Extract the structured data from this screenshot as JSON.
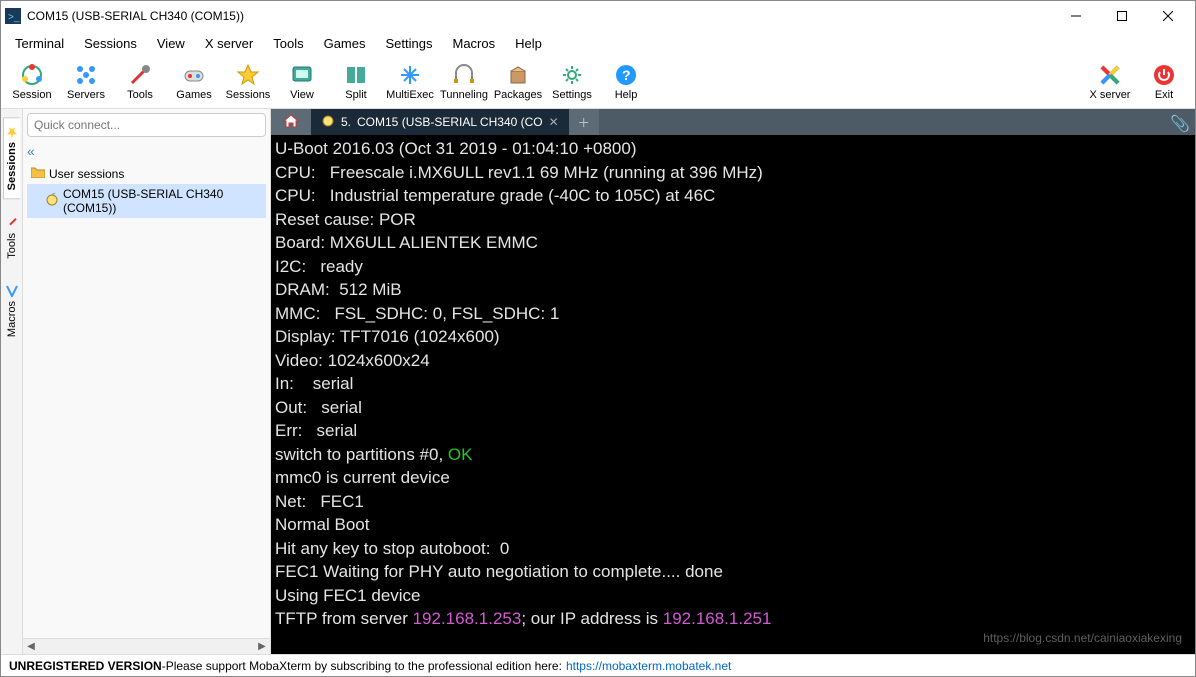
{
  "window": {
    "title": "COM15  (USB-SERIAL CH340 (COM15))"
  },
  "menu": [
    "Terminal",
    "Sessions",
    "View",
    "X server",
    "Tools",
    "Games",
    "Settings",
    "Macros",
    "Help"
  ],
  "toolbar": {
    "left": [
      {
        "label": "Session",
        "icon": "session-icon"
      },
      {
        "label": "Servers",
        "icon": "servers-icon"
      },
      {
        "label": "Tools",
        "icon": "tools-icon"
      },
      {
        "label": "Games",
        "icon": "games-icon"
      },
      {
        "label": "Sessions",
        "icon": "sessions-star-icon"
      },
      {
        "label": "View",
        "icon": "view-icon"
      },
      {
        "label": "Split",
        "icon": "split-icon"
      },
      {
        "label": "MultiExec",
        "icon": "multiexec-icon"
      },
      {
        "label": "Tunneling",
        "icon": "tunneling-icon"
      },
      {
        "label": "Packages",
        "icon": "packages-icon"
      },
      {
        "label": "Settings",
        "icon": "settings-icon"
      },
      {
        "label": "Help",
        "icon": "help-icon"
      }
    ],
    "right": [
      {
        "label": "X server",
        "icon": "xserver-icon"
      },
      {
        "label": "Exit",
        "icon": "exit-icon"
      }
    ]
  },
  "quick_connect": {
    "placeholder": "Quick connect..."
  },
  "side_tabs": [
    "Sessions",
    "Tools",
    "Macros"
  ],
  "session_tree": {
    "root": "User sessions",
    "item": "COM15  (USB-SERIAL CH340 (COM15))"
  },
  "tabs": {
    "active": {
      "index": "5.",
      "label": "COM15  (USB-SERIAL CH340 (CO"
    }
  },
  "terminal_lines": [
    {
      "t": "U-Boot 2016.03 (Oct 31 2019 - 01:04:10 +0800)"
    },
    {
      "t": ""
    },
    {
      "t": "CPU:   Freescale i.MX6ULL rev1.1 69 MHz (running at 396 MHz)"
    },
    {
      "t": "CPU:   Industrial temperature grade (-40C to 105C) at 46C"
    },
    {
      "t": "Reset cause: POR"
    },
    {
      "t": "Board: MX6ULL ALIENTEK EMMC"
    },
    {
      "t": "I2C:   ready"
    },
    {
      "t": "DRAM:  512 MiB"
    },
    {
      "t": "MMC:   FSL_SDHC: 0, FSL_SDHC: 1"
    },
    {
      "t": "Display: TFT7016 (1024x600)"
    },
    {
      "t": "Video: 1024x600x24"
    },
    {
      "t": "In:    serial"
    },
    {
      "t": "Out:   serial"
    },
    {
      "t": "Err:   serial"
    },
    {
      "spans": [
        {
          "t": "switch to partitions #0, "
        },
        {
          "t": "OK",
          "cls": "green"
        }
      ]
    },
    {
      "t": "mmc0 is current device"
    },
    {
      "t": "Net:   FEC1"
    },
    {
      "t": "Normal Boot"
    },
    {
      "t": "Hit any key to stop autoboot:  0"
    },
    {
      "t": "FEC1 Waiting for PHY auto negotiation to complete.... done"
    },
    {
      "t": "Using FEC1 device"
    },
    {
      "spans": [
        {
          "t": "TFTP from server "
        },
        {
          "t": "192.168.1.253",
          "cls": "magenta"
        },
        {
          "t": "; our IP address is "
        },
        {
          "t": "192.168.1.251",
          "cls": "magenta"
        }
      ]
    }
  ],
  "status": {
    "unreg": "UNREGISTERED VERSION",
    "dash": "  -  ",
    "msg": "Please support MobaXterm by subscribing to the professional edition here:",
    "url": "https://mobaxterm.mobatek.net"
  },
  "watermark": "https://blog.csdn.net/cainiaoxiakexing"
}
